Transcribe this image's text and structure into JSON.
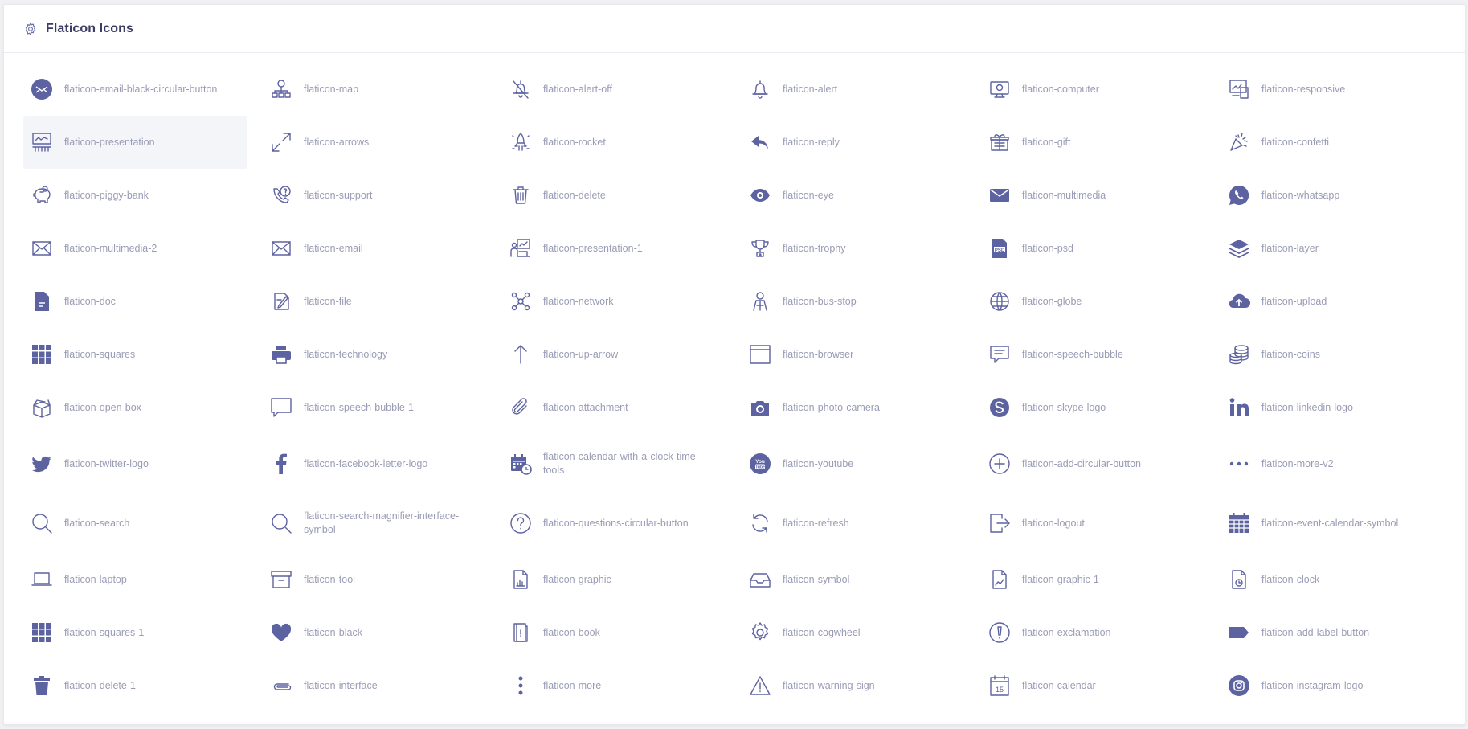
{
  "header": {
    "title": "Flaticon Icons",
    "icon": "gear-icon"
  },
  "icons": [
    {
      "label": "flaticon-email-black-circular-button",
      "icon": "email-circle"
    },
    {
      "label": "flaticon-map",
      "icon": "map"
    },
    {
      "label": "flaticon-alert-off",
      "icon": "bell-off"
    },
    {
      "label": "flaticon-alert",
      "icon": "bell"
    },
    {
      "label": "flaticon-computer",
      "icon": "computer"
    },
    {
      "label": "flaticon-responsive",
      "icon": "responsive"
    },
    {
      "label": "flaticon-presentation",
      "icon": "presentation"
    },
    {
      "label": "flaticon-arrows",
      "icon": "arrows-expand"
    },
    {
      "label": "flaticon-rocket",
      "icon": "rocket"
    },
    {
      "label": "flaticon-reply",
      "icon": "reply"
    },
    {
      "label": "flaticon-gift",
      "icon": "gift"
    },
    {
      "label": "flaticon-confetti",
      "icon": "confetti"
    },
    {
      "label": "flaticon-piggy-bank",
      "icon": "piggy-bank"
    },
    {
      "label": "flaticon-support",
      "icon": "phone-question"
    },
    {
      "label": "flaticon-delete",
      "icon": "trash"
    },
    {
      "label": "flaticon-eye",
      "icon": "eye"
    },
    {
      "label": "flaticon-multimedia",
      "icon": "envelope-filled"
    },
    {
      "label": "flaticon-whatsapp",
      "icon": "whatsapp"
    },
    {
      "label": "flaticon-multimedia-2",
      "icon": "envelope-outline"
    },
    {
      "label": "flaticon-email",
      "icon": "envelope-outline"
    },
    {
      "label": "flaticon-presentation-1",
      "icon": "presentation-people"
    },
    {
      "label": "flaticon-trophy",
      "icon": "trophy"
    },
    {
      "label": "flaticon-psd",
      "icon": "psd-file"
    },
    {
      "label": "flaticon-layer",
      "icon": "layers"
    },
    {
      "label": "flaticon-doc",
      "icon": "doc"
    },
    {
      "label": "flaticon-file",
      "icon": "file-pen"
    },
    {
      "label": "flaticon-network",
      "icon": "network"
    },
    {
      "label": "flaticon-bus-stop",
      "icon": "bus-stop"
    },
    {
      "label": "flaticon-globe",
      "icon": "globe"
    },
    {
      "label": "flaticon-upload",
      "icon": "cloud-upload"
    },
    {
      "label": "flaticon-squares",
      "icon": "grid-squares"
    },
    {
      "label": "flaticon-technology",
      "icon": "printer"
    },
    {
      "label": "flaticon-up-arrow",
      "icon": "arrow-up"
    },
    {
      "label": "flaticon-browser",
      "icon": "browser"
    },
    {
      "label": "flaticon-speech-bubble",
      "icon": "speech-bubble"
    },
    {
      "label": "flaticon-coins",
      "icon": "coins"
    },
    {
      "label": "flaticon-open-box",
      "icon": "open-box"
    },
    {
      "label": "flaticon-speech-bubble-1",
      "icon": "speech-bubble-outline"
    },
    {
      "label": "flaticon-attachment",
      "icon": "paperclip"
    },
    {
      "label": "flaticon-photo-camera",
      "icon": "camera"
    },
    {
      "label": "flaticon-skype-logo",
      "icon": "skype"
    },
    {
      "label": "flaticon-linkedin-logo",
      "icon": "linkedin"
    },
    {
      "label": "flaticon-twitter-logo",
      "icon": "twitter"
    },
    {
      "label": "flaticon-facebook-letter-logo",
      "icon": "facebook"
    },
    {
      "label": "flaticon-calendar-with-a-clock-time-tools",
      "icon": "calendar-clock"
    },
    {
      "label": "flaticon-youtube",
      "icon": "youtube"
    },
    {
      "label": "flaticon-add-circular-button",
      "icon": "plus-circle"
    },
    {
      "label": "flaticon-more-v2",
      "icon": "dots-horizontal"
    },
    {
      "label": "flaticon-search",
      "icon": "search"
    },
    {
      "label": "flaticon-search-magnifier-interface-symbol",
      "icon": "search"
    },
    {
      "label": "flaticon-questions-circular-button",
      "icon": "question-circle"
    },
    {
      "label": "flaticon-refresh",
      "icon": "refresh"
    },
    {
      "label": "flaticon-logout",
      "icon": "logout"
    },
    {
      "label": "flaticon-event-calendar-symbol",
      "icon": "calendar-grid"
    },
    {
      "label": "flaticon-laptop",
      "icon": "laptop"
    },
    {
      "label": "flaticon-tool",
      "icon": "archive-box"
    },
    {
      "label": "flaticon-graphic",
      "icon": "file-chart"
    },
    {
      "label": "flaticon-symbol",
      "icon": "inbox-tray"
    },
    {
      "label": "flaticon-graphic-1",
      "icon": "file-line-chart"
    },
    {
      "label": "flaticon-clock",
      "icon": "file-clock"
    },
    {
      "label": "flaticon-squares-1",
      "icon": "grid-squares"
    },
    {
      "label": "flaticon-black",
      "icon": "heart"
    },
    {
      "label": "flaticon-book",
      "icon": "book"
    },
    {
      "label": "flaticon-cogwheel",
      "icon": "cog"
    },
    {
      "label": "flaticon-exclamation",
      "icon": "exclamation-circle"
    },
    {
      "label": "flaticon-add-label-button",
      "icon": "label-tag"
    },
    {
      "label": "flaticon-delete-1",
      "icon": "trash-filled"
    },
    {
      "label": "flaticon-interface",
      "icon": "paperclip-horizontal"
    },
    {
      "label": "flaticon-more",
      "icon": "dots-vertical"
    },
    {
      "label": "flaticon-warning-sign",
      "icon": "warning-triangle"
    },
    {
      "label": "flaticon-calendar",
      "icon": "calendar-15"
    },
    {
      "label": "flaticon-instagram-logo",
      "icon": "instagram"
    }
  ],
  "active_index": 6,
  "colors": {
    "icon": "#5d62a0",
    "label": "#9a9cb5",
    "title": "#3b3d63"
  }
}
